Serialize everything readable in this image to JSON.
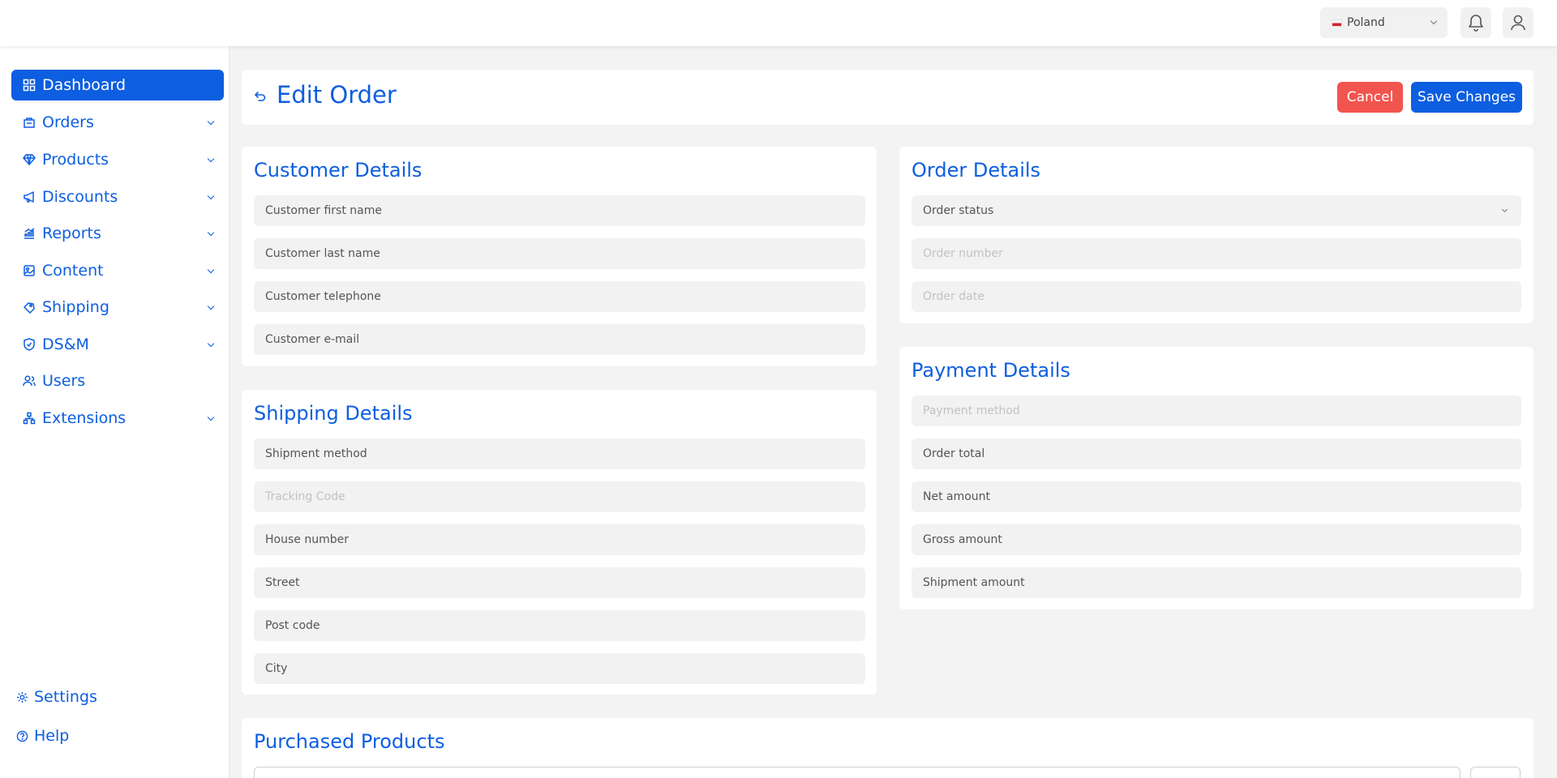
{
  "topbar": {
    "country": "Poland"
  },
  "sidebar": {
    "items": [
      {
        "label": "Dashboard",
        "icon": "dashboard-icon",
        "active": true
      },
      {
        "label": "Orders",
        "icon": "orders-icon"
      },
      {
        "label": "Products",
        "icon": "gem-icon"
      },
      {
        "label": "Discounts",
        "icon": "megaphone-icon"
      },
      {
        "label": "Reports",
        "icon": "chart-icon"
      },
      {
        "label": "Content",
        "icon": "content-icon"
      },
      {
        "label": "Shipping",
        "icon": "shipping-icon"
      },
      {
        "label": "DS&M",
        "icon": "shield-icon"
      },
      {
        "label": "Users",
        "icon": "users-icon"
      },
      {
        "label": "Extensions",
        "icon": "extensions-icon"
      }
    ],
    "settings": "Settings",
    "help": "Help"
  },
  "header": {
    "title": "Edit Order",
    "cancel": "Cancel",
    "save": "Save Changes"
  },
  "customer": {
    "title": "Customer Details",
    "fields": [
      "Customer first name",
      "Customer last name",
      "Customer telephone",
      "Customer e-mail"
    ]
  },
  "shipping": {
    "title": "Shipping Details",
    "fields": [
      "Shipment method",
      "Tracking Code",
      "House number",
      "Street",
      "Post code",
      "City"
    ]
  },
  "order": {
    "title": "Order Details",
    "status": "Order status",
    "number": "Order number",
    "date": "Order date"
  },
  "payment": {
    "title": "Payment Details",
    "fields": [
      "Payment method",
      "Order total",
      "Net amount",
      "Gross amount",
      "Shipment amount"
    ]
  },
  "products": {
    "title": "Purchased Products"
  },
  "colors": {
    "primary": "#0d5ee0",
    "danger": "#f2544f",
    "background": "#f3f3f3"
  }
}
